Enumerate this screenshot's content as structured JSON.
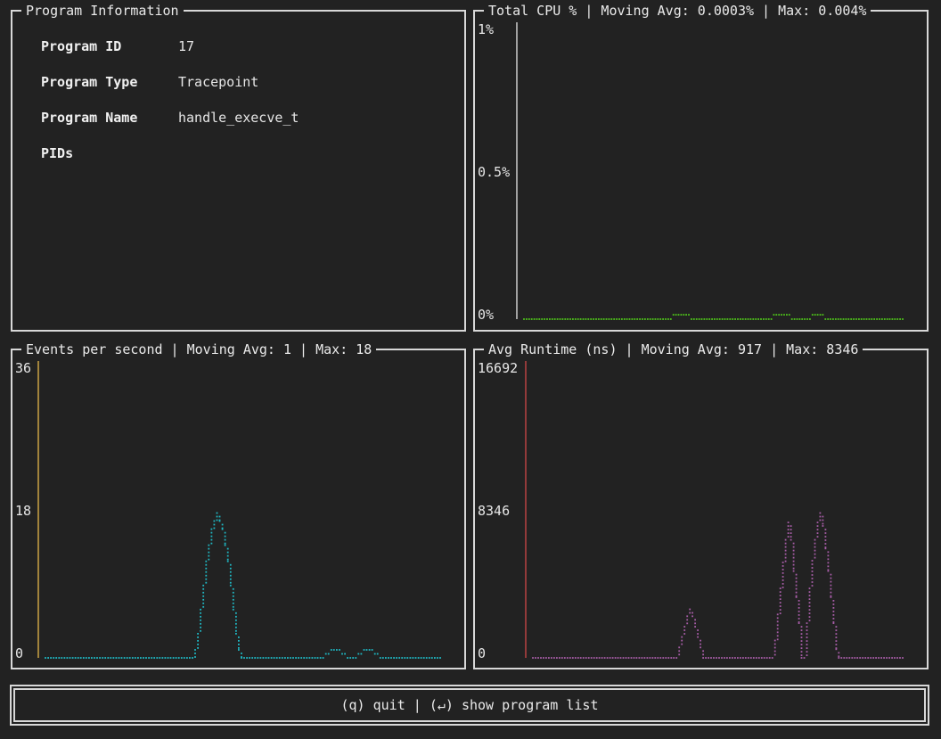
{
  "info_panel": {
    "title": "Program Information",
    "rows": [
      {
        "label": "Program ID",
        "value": "17"
      },
      {
        "label": "Program Type",
        "value": "Tracepoint"
      },
      {
        "label": "Program Name",
        "value": "handle_execve_t"
      },
      {
        "label": "PIDs",
        "value": ""
      }
    ]
  },
  "footer": {
    "quit": "(q) quit",
    "separator": " | ",
    "list": "(↵) show program list"
  },
  "chart_data": [
    {
      "type": "line",
      "title": "Total CPU % | Moving Avg: 0.0003% | Max: 0.004%",
      "y_ticks": [
        "1%",
        "0.5%",
        "0%"
      ],
      "ylim": [
        0,
        1
      ],
      "color": "#4ec31a",
      "axis_color": "#e6e6e6",
      "values": [
        0,
        0,
        0,
        0,
        0,
        0,
        0,
        0,
        0,
        0,
        0,
        0,
        0,
        0,
        0,
        0,
        0,
        0,
        0,
        0,
        0,
        0,
        0,
        0,
        0,
        0,
        0,
        0,
        0,
        0,
        0,
        0,
        0,
        0,
        0,
        0,
        0,
        0,
        0,
        0,
        0,
        0,
        0,
        0,
        0,
        0,
        0,
        0,
        0,
        0,
        0,
        0,
        0,
        0,
        0,
        0,
        0,
        0,
        0.015,
        0.015,
        0.015,
        0.015,
        0.015,
        0.015,
        0.015,
        0,
        0,
        0,
        0,
        0,
        0,
        0,
        0,
        0,
        0,
        0,
        0,
        0,
        0,
        0,
        0,
        0,
        0,
        0,
        0,
        0,
        0,
        0,
        0,
        0,
        0,
        0,
        0,
        0,
        0,
        0,
        0,
        0.015,
        0.015,
        0.015,
        0.015,
        0.015,
        0.015,
        0.015,
        0,
        0,
        0,
        0,
        0,
        0,
        0,
        0,
        0.015,
        0.015,
        0.015,
        0.015,
        0.015,
        0,
        0,
        0,
        0,
        0,
        0,
        0,
        0,
        0,
        0,
        0,
        0,
        0,
        0,
        0,
        0,
        0,
        0,
        0,
        0,
        0,
        0,
        0,
        0,
        0,
        0,
        0,
        0,
        0,
        0,
        0
      ]
    },
    {
      "type": "line",
      "title": "Events per second | Moving Avg: 1 | Max: 18",
      "y_ticks": [
        "36",
        "18",
        "0"
      ],
      "ylim": [
        0,
        36
      ],
      "color": "#1fb8c4",
      "axis_color": "#e6b84a",
      "values": [
        0,
        0,
        0,
        0,
        0,
        0,
        0,
        0,
        0,
        0,
        0,
        0,
        0,
        0,
        0,
        0,
        0,
        0,
        0,
        0,
        0,
        0,
        0,
        0,
        0,
        0,
        0,
        0,
        0,
        0,
        0,
        0,
        0,
        0,
        0,
        0,
        0,
        0,
        0,
        0,
        0,
        0,
        0,
        0,
        0,
        0,
        0,
        0,
        0,
        0,
        0,
        0,
        0,
        0,
        0,
        1,
        3,
        6,
        9,
        12,
        14,
        16,
        17,
        18,
        17,
        16,
        14,
        12,
        9,
        6,
        3,
        1,
        0,
        0,
        0,
        0,
        0,
        0,
        0,
        0,
        0,
        0,
        0,
        0,
        0,
        0,
        0,
        0,
        0,
        0,
        0,
        0,
        0,
        0,
        0,
        0,
        0,
        0,
        0,
        0,
        0,
        0,
        0,
        0.5,
        0.5,
        1,
        1,
        1,
        1,
        0.5,
        0.5,
        0,
        0,
        0,
        0,
        0.5,
        0.5,
        1,
        1,
        1,
        1,
        0.5,
        0.5,
        0,
        0,
        0,
        0,
        0,
        0,
        0,
        0,
        0,
        0,
        0,
        0,
        0,
        0,
        0,
        0,
        0,
        0,
        0,
        0,
        0,
        0,
        0
      ]
    },
    {
      "type": "line",
      "title": "Avg Runtime (ns) | Moving Avg: 917 | Max: 8346",
      "y_ticks": [
        "16692",
        "8346",
        "0"
      ],
      "ylim": [
        0,
        16692
      ],
      "color": "#a65ca6",
      "axis_color": "#d04848",
      "values": [
        0,
        0,
        0,
        0,
        0,
        0,
        0,
        0,
        0,
        0,
        0,
        0,
        0,
        0,
        0,
        0,
        0,
        0,
        0,
        0,
        0,
        0,
        0,
        0,
        0,
        0,
        0,
        0,
        0,
        0,
        0,
        0,
        0,
        0,
        0,
        0,
        0,
        0,
        0,
        0,
        0,
        0,
        0,
        0,
        0,
        0,
        0,
        0,
        0,
        0,
        0,
        0,
        0,
        0,
        0,
        600,
        1200,
        1800,
        2400,
        2800,
        2400,
        1800,
        1200,
        600,
        0,
        0,
        0,
        0,
        0,
        0,
        0,
        0,
        0,
        0,
        0,
        0,
        0,
        0,
        0,
        0,
        0,
        0,
        0,
        0,
        0,
        0,
        0,
        0,
        0,
        0,
        0,
        1000,
        2500,
        4000,
        5500,
        6800,
        7800,
        6800,
        5000,
        3500,
        2000,
        0,
        0,
        2000,
        4000,
        5600,
        6800,
        7800,
        8346,
        7600,
        6300,
        5000,
        3500,
        2000,
        500,
        0,
        0,
        0,
        0,
        0,
        0,
        0,
        0,
        0,
        0,
        0,
        0,
        0,
        0,
        0,
        0,
        0,
        0,
        0,
        0,
        0,
        0,
        0,
        0,
        0
      ]
    }
  ]
}
